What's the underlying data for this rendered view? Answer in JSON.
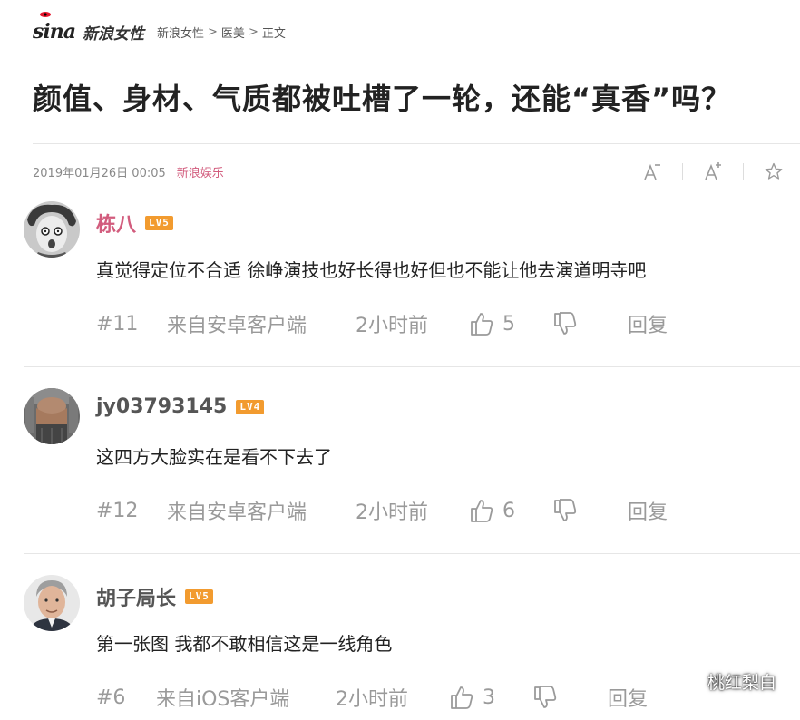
{
  "header": {
    "logo_text": "sina",
    "site_name": "新浪女性",
    "breadcrumb": {
      "home": "新浪女性",
      "sep1": ">",
      "category": "医美",
      "sep2": ">",
      "current": "正文"
    }
  },
  "article": {
    "title": "颜值、身材、气质都被吐槽了一轮，还能“真香”吗？",
    "date": "2019年01月26日 00:05",
    "source": "新浪娱乐"
  },
  "tools": {
    "font_decrease_icon": "font-decrease-icon",
    "font_increase_icon": "font-increase-icon",
    "favorite_icon": "star-icon"
  },
  "comments": [
    {
      "username": "栋八",
      "username_color": "#d25c7d",
      "level": "LV5",
      "text": "真觉得定位不合适 徐峥演技也好长得也好但也不能让他去演道明寺吧",
      "floor": "#11",
      "device": "来自安卓客户端",
      "time": "2小时前",
      "likes": "5",
      "reply_label": "回复"
    },
    {
      "username": "jy03793145",
      "username_color": "#555555",
      "level": "LV4",
      "text": "这四方大脸实在是看不下去了",
      "floor": "#12",
      "device": "来自安卓客户端",
      "time": "2小时前",
      "likes": "6",
      "reply_label": "回复"
    },
    {
      "username": "胡子局长",
      "username_color": "#555555",
      "level": "LV5",
      "text": "第一张图 我都不敢相信这是一线角色",
      "floor": "#6",
      "device": "来自iOS客户端",
      "time": "2小时前",
      "likes": "3",
      "reply_label": "回复"
    }
  ],
  "watermark": {
    "text": "桃红梨白"
  }
}
